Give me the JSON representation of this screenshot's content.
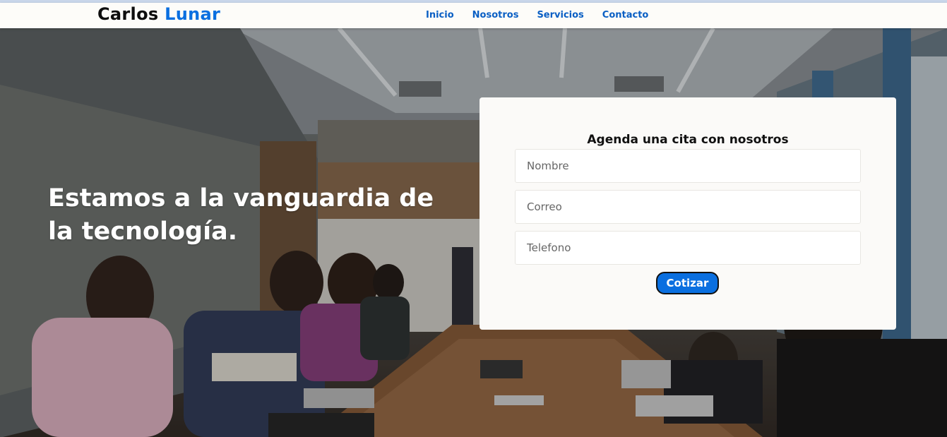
{
  "brand": {
    "first": "Carlos",
    "second": "Lunar"
  },
  "nav": {
    "items": [
      "Inicio",
      "Nosotros",
      "Servicios",
      "Contacto"
    ]
  },
  "hero": {
    "title": "Estamos a la vanguardia de la tecnología."
  },
  "form": {
    "title": "Agenda una cita con nosotros",
    "nombre_placeholder": "Nombre",
    "correo_placeholder": "Correo",
    "telefono_placeholder": "Telefono",
    "submit_label": "Cotizar"
  },
  "colors": {
    "accent": "#0a6fe0",
    "nav_link": "#0a5fc4",
    "card": "#fbfaf8"
  }
}
